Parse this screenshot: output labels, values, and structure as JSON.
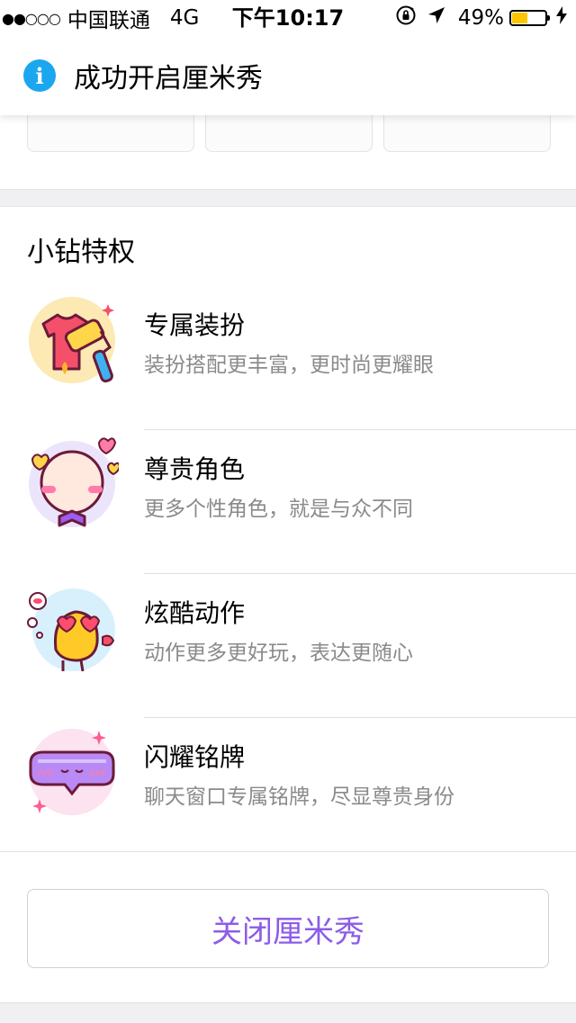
{
  "status_bar": {
    "signal": "●●○○○",
    "carrier": "中国联通",
    "network": "4G",
    "time": "下午10:17",
    "battery_percent": "49%",
    "battery_level": 0.49
  },
  "toast": {
    "icon": "info-icon",
    "message": "成功开启厘米秀"
  },
  "section": {
    "title": "小钻特权",
    "items": [
      {
        "title": "专属装扮",
        "desc": "装扮搭配更丰富，更时尚更耀眼",
        "icon": "paint-roller-shirt-icon"
      },
      {
        "title": "尊贵角色",
        "desc": "更多个性角色，就是与众不同",
        "icon": "bowtie-character-icon"
      },
      {
        "title": "炫酷动作",
        "desc": "动作更多更好玩，表达更随心",
        "icon": "heart-eyes-character-icon"
      },
      {
        "title": "闪耀铭牌",
        "desc": "聊天窗口专属铭牌，尽显尊贵身份",
        "icon": "sparkle-nameplate-icon"
      }
    ]
  },
  "close_button": "关闭厘米秀",
  "colors": {
    "accent_purple": "#8c5ce8",
    "info_blue": "#1ba6f0",
    "battery_yellow": "#ffc400"
  }
}
